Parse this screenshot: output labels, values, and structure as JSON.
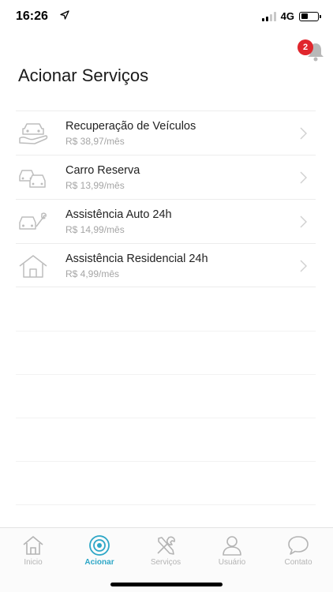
{
  "status_bar": {
    "time": "16:26",
    "network": "4G",
    "battery_level": 0.4
  },
  "notifications": {
    "badge_count": "2"
  },
  "page": {
    "title": "Acionar Serviços"
  },
  "services": [
    {
      "name": "Recuperação de Veículos",
      "price": "R$ 38,97/mês",
      "icon": "car-recovery-icon"
    },
    {
      "name": "Carro Reserva",
      "price": "R$ 13,99/mês",
      "icon": "two-cars-icon"
    },
    {
      "name": "Assistência Auto 24h",
      "price": "R$ 14,99/mês",
      "icon": "car-wrench-icon"
    },
    {
      "name": "Assistência Residencial 24h",
      "price": "R$ 4,99/mês",
      "icon": "house-icon"
    }
  ],
  "tab_bar": {
    "active_tab": "Acionar",
    "tabs": [
      {
        "label": "Inicio",
        "icon": "home-icon"
      },
      {
        "label": "Acionar",
        "icon": "target-icon"
      },
      {
        "label": "Serviços",
        "icon": "tools-icon"
      },
      {
        "label": "Usuário",
        "icon": "user-icon"
      },
      {
        "label": "Contato",
        "icon": "chat-bubble-icon"
      }
    ]
  },
  "colors": {
    "accent": "#2ea7c7",
    "badge": "#e0262c",
    "inactive": "#b4b4b4",
    "price_text": "#a5a5a5"
  }
}
